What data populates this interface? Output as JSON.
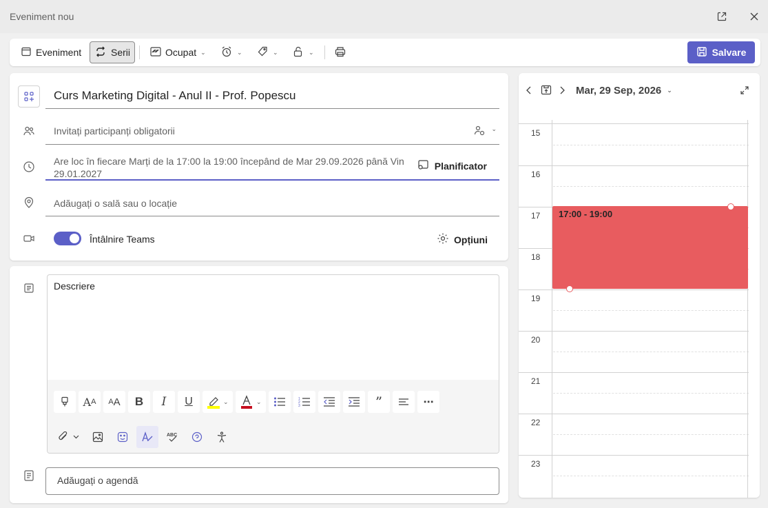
{
  "window": {
    "title": "Eveniment nou"
  },
  "toolbar": {
    "event_label": "Eveniment",
    "series_label": "Serii",
    "busy_label": "Ocupat",
    "save_label": "Salvare",
    "icons": [
      "calendar-icon",
      "repeat-icon",
      "status-icon",
      "alarm-icon",
      "tag-icon",
      "lock-icon",
      "print-icon",
      "save-icon"
    ]
  },
  "form": {
    "title": "Curs Marketing Digital - Anul II - Prof. Popescu",
    "attendees_placeholder": "Invitați participanți obligatorii",
    "recurrence_line1": "Are loc în fiecare Marți de la 17:00 la 19:00 începând de Mar 29.09.2026 până Vin",
    "recurrence_line2": "29.01.2027",
    "scheduler_label": "Planificator",
    "location_placeholder": "Adăugați o sală sau o locație",
    "teams_label": "Întâlnire Teams",
    "teams_enabled": true,
    "options_label": "Opțiuni",
    "description_label": "Descriere",
    "agenda_placeholder": "Adăugați o agendă"
  },
  "calendar": {
    "date_label": "Mar, 29 Sep, 2026",
    "hours": [
      "15",
      "16",
      "17",
      "18",
      "19",
      "20",
      "21",
      "22",
      "23"
    ],
    "event_label": "17:00 - 19:00",
    "event_color": "#e85c5f"
  },
  "colors": {
    "accent": "#5b5fc7",
    "highlight": "#ffff00",
    "font_color": "#c50f1f"
  }
}
